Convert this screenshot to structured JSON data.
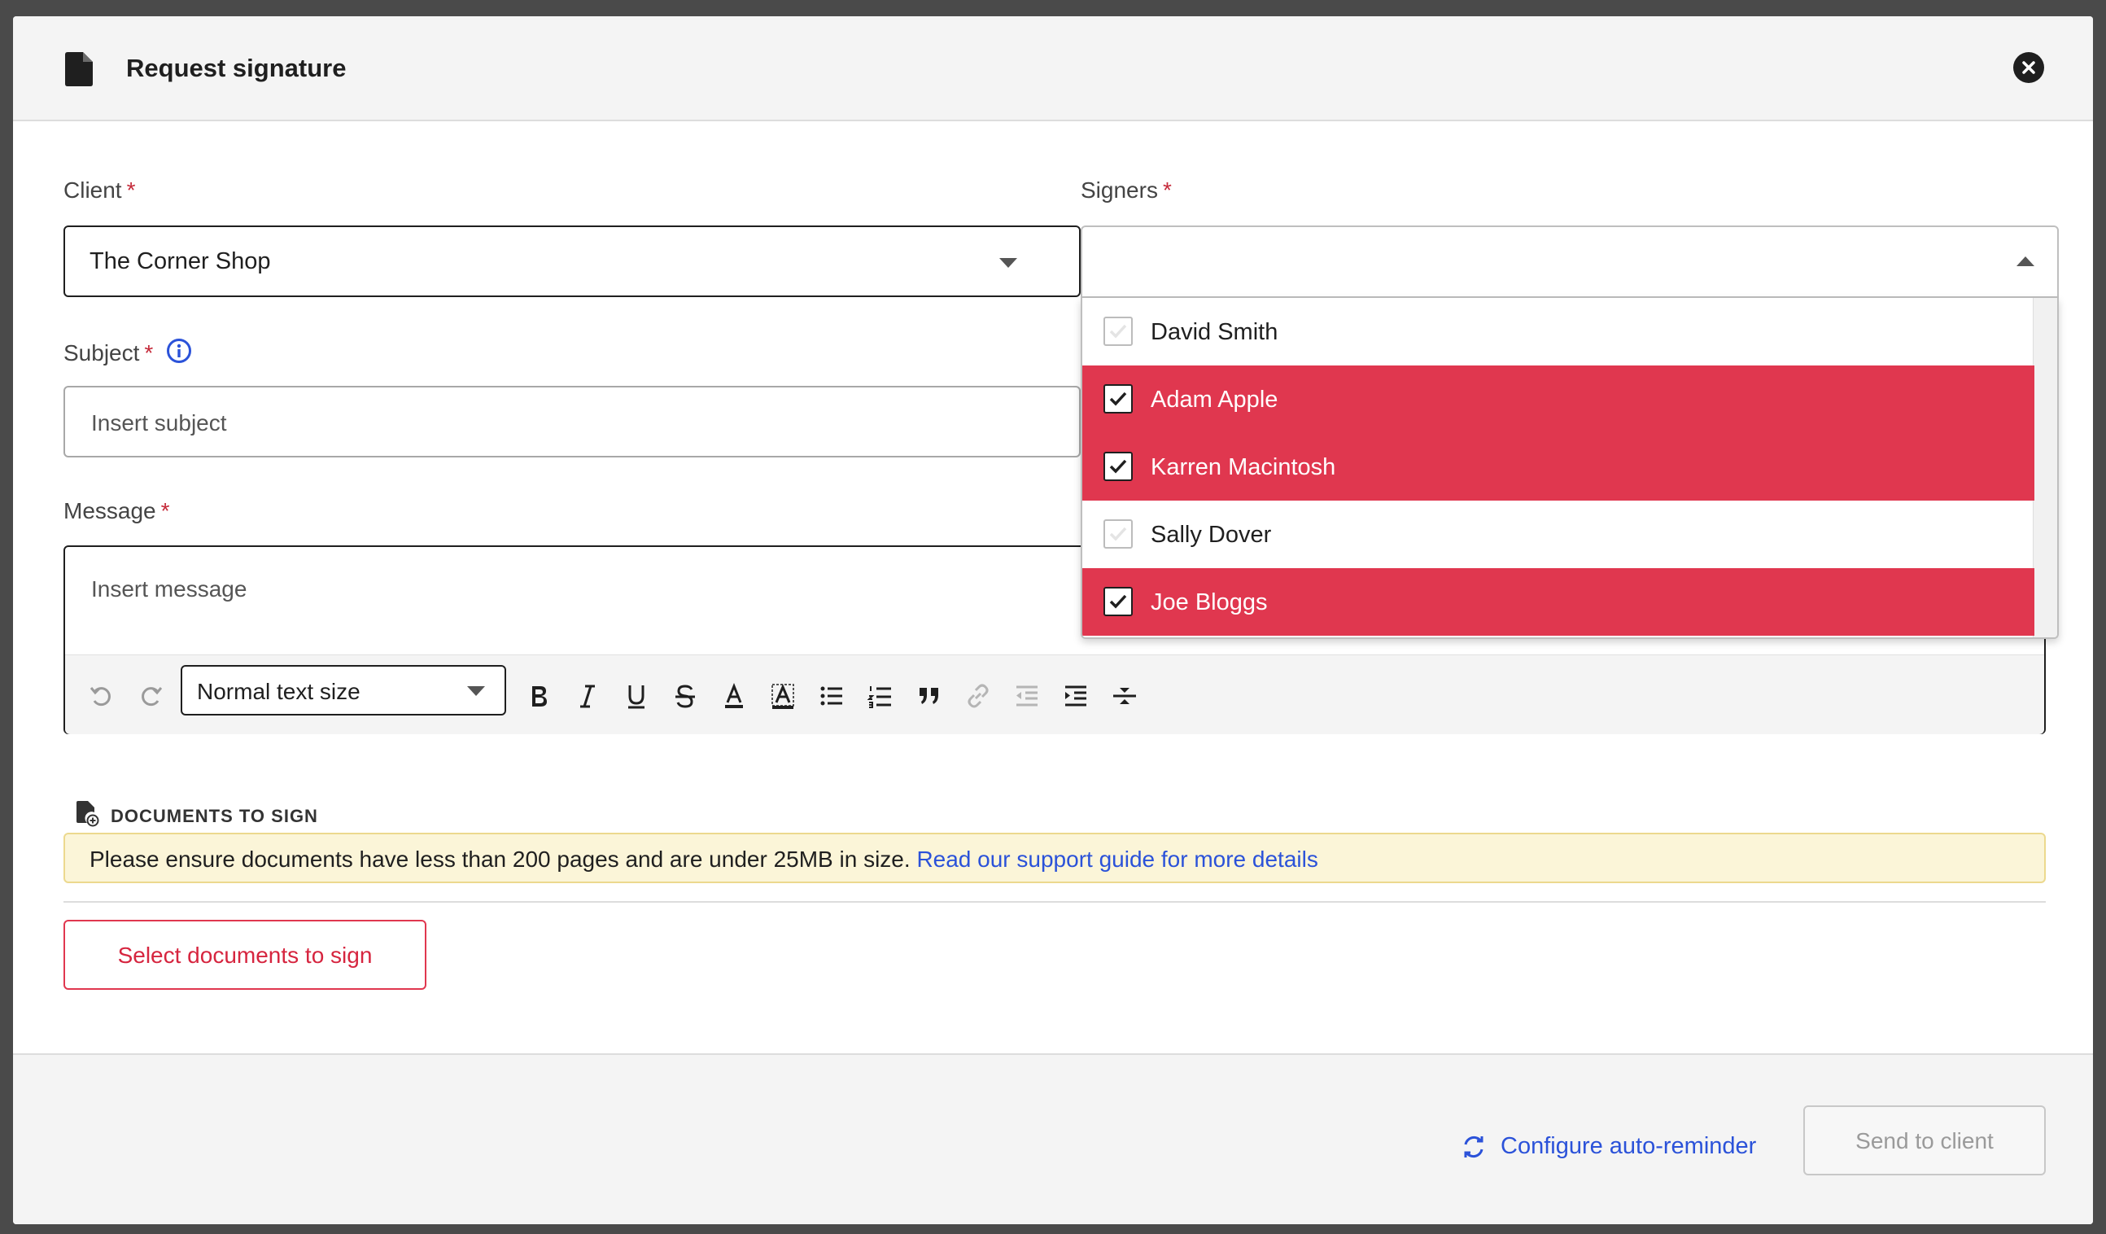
{
  "modal": {
    "title": "Request signature",
    "header_icon": "document-icon",
    "close_icon": "close-icon"
  },
  "client": {
    "label": "Client",
    "required_mark": "*",
    "value": "The Corner Shop"
  },
  "signers": {
    "label": "Signers",
    "required_mark": "*",
    "value": "",
    "options": [
      {
        "name": "David Smith",
        "checked": false
      },
      {
        "name": "Adam Apple",
        "checked": true
      },
      {
        "name": "Karren Macintosh",
        "checked": true
      },
      {
        "name": "Sally Dover",
        "checked": false
      },
      {
        "name": "Joe Bloggs",
        "checked": true
      }
    ],
    "selected_color": "#e0374f"
  },
  "subject": {
    "label": "Subject",
    "required_mark": "*",
    "placeholder": "Insert subject",
    "info_icon": "info-icon"
  },
  "message": {
    "label": "Message",
    "required_mark": "*",
    "placeholder": "Insert message",
    "toolbar": {
      "text_size": "Normal text size",
      "icons": [
        "undo-icon",
        "redo-icon",
        "bold-icon",
        "italic-icon",
        "underline-icon",
        "strikethrough-icon",
        "text-color-icon",
        "highlight-icon",
        "bullet-list-icon",
        "numbered-list-icon",
        "quote-icon",
        "link-icon",
        "outdent-icon",
        "indent-icon",
        "horizontal-rule-icon"
      ]
    }
  },
  "documents": {
    "section_title": "DOCUMENTS TO SIGN",
    "notice_text": "Please ensure documents have less than 200 pages and are under 25MB in size.",
    "notice_link": "Read our support guide for more details",
    "select_button": "Select documents to sign"
  },
  "footer": {
    "reminder_link": "Configure auto-reminder",
    "send_button": "Send to client"
  },
  "colors": {
    "accent_red": "#e0374f",
    "link_blue": "#2b52d9",
    "notice_bg": "#fbf5d8"
  }
}
